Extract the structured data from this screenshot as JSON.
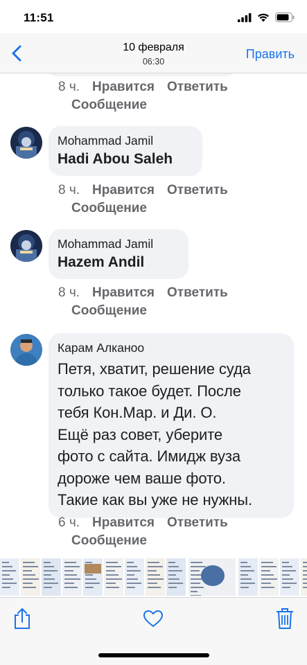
{
  "status_bar": {
    "time": "11:51"
  },
  "nav": {
    "title": "10 февраля",
    "subtitle": "06:30",
    "edit_label": "Править"
  },
  "comments": [
    {
      "author": "",
      "tagged": "",
      "text": "",
      "time": "8 ч.",
      "like_label": "Нравится",
      "reply_label": "Ответить",
      "message_label": "Сообщение"
    },
    {
      "author": "Mohammad Jamil",
      "tagged": "Hadi Abou Saleh",
      "time": "8 ч.",
      "like_label": "Нравится",
      "reply_label": "Ответить",
      "message_label": "Сообщение"
    },
    {
      "author": "Mohammad Jamil",
      "tagged": "Hazem Andil",
      "time": "8 ч.",
      "like_label": "Нравится",
      "reply_label": "Ответить",
      "message_label": "Сообщение"
    },
    {
      "author": "Карам Алканоо",
      "text_lines": [
        "Петя, хватит, решение суда",
        "только такое будет. После",
        "тебя Кон.Мар.  и Ди. О.",
        "Ещё раз совет, уберите",
        "фото с сайта. Имидж вуза",
        "дороже чем ваше фото.",
        "Такие как вы уже не нужны."
      ],
      "time": "6 ч.",
      "like_label": "Нравится",
      "reply_label": "Ответить",
      "message_label": "Сообщение"
    }
  ],
  "toolbar": {
    "share_icon": "share-icon",
    "like_icon": "heart-icon",
    "delete_icon": "trash-icon"
  },
  "colors": {
    "accent": "#1a73e8",
    "bubble": "#f0f2f5",
    "meta_text": "#65676b"
  }
}
